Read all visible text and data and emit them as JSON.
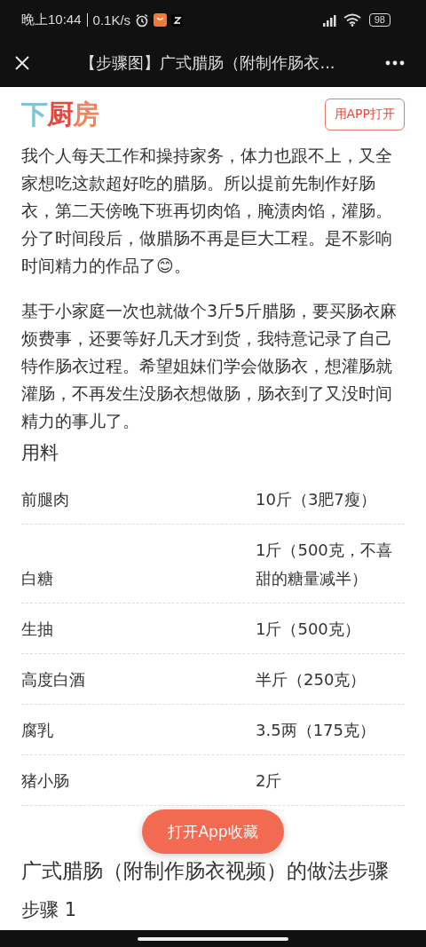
{
  "status_bar": {
    "time": "晚上10:44",
    "speed": "0.1K/s",
    "battery": "98"
  },
  "title_bar": {
    "title": "【步骤图】广式腊肠（附制作肠衣..."
  },
  "header": {
    "logo": [
      {
        "char": "下",
        "color": "#7cc4d6"
      },
      {
        "char": "厨",
        "color": "#e8463a"
      },
      {
        "char": "房",
        "color": "#f5845a"
      }
    ],
    "open_app": "用APP打开"
  },
  "intro": [
    "我个人每天工作和操持家务，体力也跟不上，又全家想吃这款超好吃的腊肠。所以提前先制作好肠衣，第二天傍晚下班再切肉馅，腌渍肉馅，灌肠。分了时间段后，做腊肠不再是巨大工程。是不影响时间精力的作品了😊。",
    "基于小家庭一次也就做个3斤5斤腊肠，要买肠衣麻烦费事，还要等好几天才到货，我特意记录了自己特作肠衣过程。希望姐妹们学会做肠衣，想灌肠就灌肠，不再发生没肠衣想做肠，肠衣到了又没时间精力的事儿了。"
  ],
  "ingredients": {
    "heading": "用料",
    "rows": [
      {
        "name": "前腿肉",
        "amount": "10斤（3肥7瘦）"
      },
      {
        "name": "白糖",
        "amount": "1斤（500克，不喜甜的糖量减半）"
      },
      {
        "name": "生抽",
        "amount": "1斤（500克）"
      },
      {
        "name": "高度白酒",
        "amount": "半斤（250克）"
      },
      {
        "name": "腐乳",
        "amount": "3.5两（175克）"
      },
      {
        "name": "猪小肠",
        "amount": "2斤"
      }
    ]
  },
  "floating_button": "打开App收藏",
  "steps": {
    "heading": "广式腊肠（附制作肠衣视频）的做法步骤",
    "first_step": "步骤 1"
  }
}
